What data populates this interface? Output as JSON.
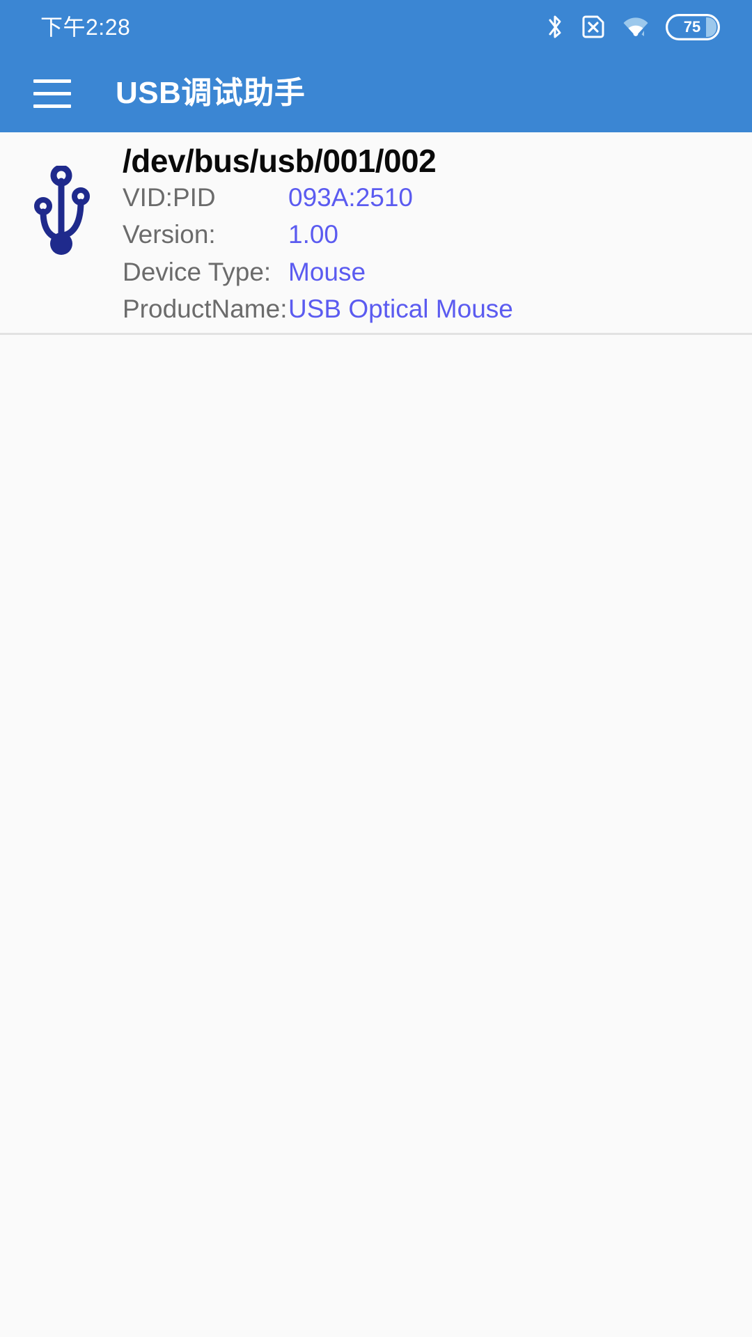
{
  "status_bar": {
    "time": "下午2:28",
    "battery_level": "75",
    "icons": [
      "bluetooth-icon",
      "sim-card-missing-icon",
      "wifi-icon",
      "battery-icon"
    ]
  },
  "app_bar": {
    "menu_icon": "hamburger-menu-icon",
    "title": "USB调试助手"
  },
  "colors": {
    "app_bar_blue": "#3B86D3",
    "page_background": "#FAFAFA",
    "value_blue": "#5B5BF0",
    "label_gray": "#6B6B6B",
    "usb_icon_navy": "#1F2A8C",
    "divider_gray": "#E2E2E2"
  },
  "devices": [
    {
      "icon": "usb-icon",
      "path": "/dev/bus/usb/001/002",
      "fields": [
        {
          "label": "VID:PID",
          "value": "093A:2510"
        },
        {
          "label": "Version:",
          "value": "1.00"
        },
        {
          "label": "Device Type:",
          "value": "Mouse"
        },
        {
          "label": "ProductName:",
          "value": "USB Optical Mouse"
        }
      ]
    }
  ]
}
